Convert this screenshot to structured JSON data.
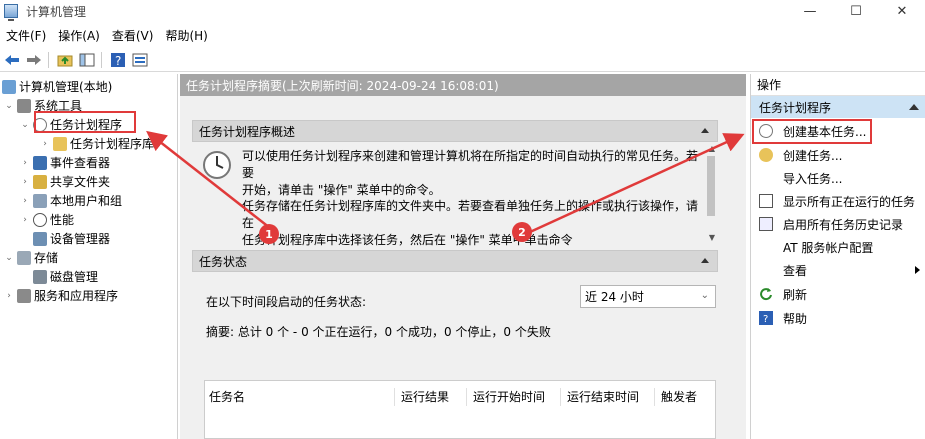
{
  "window": {
    "title": "计算机管理",
    "controls": {
      "minimize": "—",
      "maximize": "☐",
      "close": "✕"
    }
  },
  "menu": {
    "file": "文件(F)",
    "action": "操作(A)",
    "view": "查看(V)",
    "help": "帮助(H)"
  },
  "toolbar": {
    "icons": [
      "back-arrow-icon",
      "forward-arrow-icon",
      "up-folder-icon",
      "show-hide-tree-icon",
      "help-icon",
      "properties-icon"
    ]
  },
  "tree": {
    "root": "计算机管理(本地)",
    "system_tools": "系统工具",
    "task_scheduler": "任务计划程序",
    "task_scheduler_library": "任务计划程序库",
    "event_viewer": "事件查看器",
    "shared_folders": "共享文件夹",
    "local_users_groups": "本地用户和组",
    "performance": "性能",
    "device_manager": "设备管理器",
    "storage": "存储",
    "disk_management": "磁盘管理",
    "services_apps": "服务和应用程序"
  },
  "middle": {
    "header": "任务计划程序摘要(上次刷新时间: 2024-09-24 16:08:01)",
    "overview_title": "任务计划程序概述",
    "overview_p1_l1": "可以使用任务计划程序来创建和管理计算机将在所指定的时间自动执行的常见任务。若要",
    "overview_p1_l2": "开始，请单击 \"操作\" 菜单中的命令。",
    "overview_p2_l1": "任务存储在任务计划程序库的文件夹中。若要查看单独任务上的操作或执行该操作，请在",
    "overview_p2_l2": "任务计划程序库中选择该任务，然后在 \"操作\" 菜单中单击命令",
    "status_title": "任务状态",
    "status_label": "在以下时间段启动的任务状态:",
    "status_select": "近 24 小时",
    "summary": "摘要: 总计 0 个 - 0 个正在运行，0 个成功，0 个停止，0 个失败",
    "table_headers": [
      "任务名",
      "运行结果",
      "运行开始时间",
      "运行结束时间",
      "触发者"
    ]
  },
  "actions": {
    "header": "操作",
    "group": "任务计划程序",
    "items": [
      "创建基本任务...",
      "创建任务...",
      "导入任务...",
      "显示所有正在运行的任务",
      "启用所有任务历史记录",
      "AT 服务帐户配置",
      "查看",
      "刷新",
      "帮助"
    ]
  },
  "annotations": {
    "badge1": "1",
    "badge2": "2",
    "color": "#e03a3a"
  }
}
